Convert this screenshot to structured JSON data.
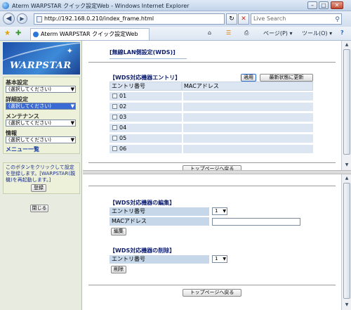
{
  "window": {
    "title": "Aterm WARPSTAR クイック設定Web - Windows Internet Explorer",
    "min": "–",
    "max": "□",
    "close": "✕"
  },
  "nav": {
    "back": "◀",
    "forward": "▶",
    "url": "http://192.168.0.210/index_frame.html",
    "refresh": "↻",
    "stop": "✕",
    "search_placeholder": "Live Search",
    "search_icon": "search-icon"
  },
  "tabbar": {
    "tab_title": "Aterm WARPSTAR クイック設定Web",
    "home": "⌂",
    "feeds": "☰",
    "print": "⎙",
    "page_menu": "ページ(P) ▾",
    "tools_menu": "ツール(O) ▾",
    "help": "?"
  },
  "left": {
    "logo_text": "WARPSTAR",
    "logo_star": "✦",
    "sections": [
      {
        "label": "基本設定",
        "selected": "(選択してください)"
      },
      {
        "label": "詳細設定",
        "selected": "(選択してください)"
      },
      {
        "label": "メンテナンス",
        "selected": "(選択してください)"
      },
      {
        "label": "情報",
        "selected": "(選択してください)"
      }
    ],
    "menu_list_link": "メニュー一覧",
    "note": "このボタンをクリックして設定を登録します。[WARPSTAR(親機)を再起動します。]",
    "register_button": "登録",
    "close_button": "閉じる"
  },
  "main": {
    "page_title": "[無線LAN側設定(WDS)]",
    "entry_heading": "【WDS対応機器エントリ】",
    "apply_button": "適用",
    "refresh_button": "最新状態に更新",
    "col_entry": "エントリ番号",
    "col_mac": "MACアドレス",
    "entries": [
      "01",
      "02",
      "03",
      "04",
      "05",
      "06"
    ],
    "top_button": "トップページへ戻る"
  },
  "bottom": {
    "edit_heading": "【WDS対応機器の編集】",
    "entry_label": "エントリ番号",
    "entry_value": "1",
    "mac_label": "MACアドレス",
    "edit_button": "編集",
    "delete_heading": "【WDS対応機器の削除】",
    "del_entry_label": "エントリ番号",
    "del_entry_value": "1",
    "delete_button": "削除",
    "top_button": "トップページへ戻る"
  }
}
